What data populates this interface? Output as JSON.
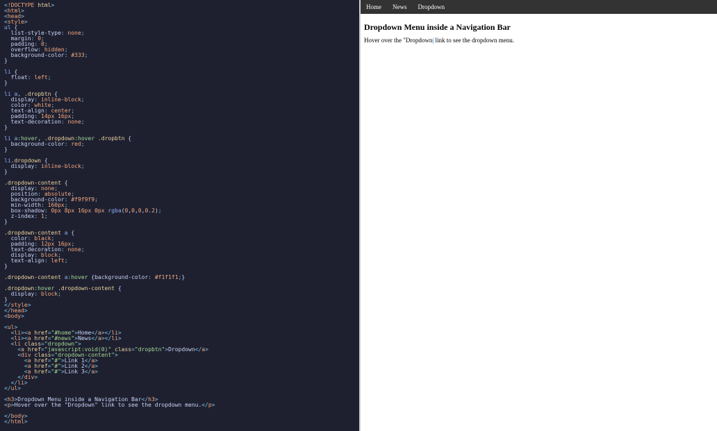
{
  "code": {
    "lines": [
      {
        "t": "tag",
        "text": "<!DOCTYPE html>"
      },
      {
        "t": "tag",
        "text": "<html>"
      },
      {
        "t": "tag",
        "text": "<head>"
      },
      {
        "t": "tag",
        "text": "<style>"
      },
      {
        "t": "sel",
        "text": "ul {"
      },
      {
        "t": "prop",
        "text": "  list-style-type: none;"
      },
      {
        "t": "prop",
        "text": "  margin: 0;"
      },
      {
        "t": "prop",
        "text": "  padding: 0;"
      },
      {
        "t": "prop",
        "text": "  overflow: hidden;"
      },
      {
        "t": "prop",
        "text": "  background-color: #333;"
      },
      {
        "t": "brace",
        "text": "}"
      },
      {
        "t": "blank",
        "text": ""
      },
      {
        "t": "sel",
        "text": "li {"
      },
      {
        "t": "prop",
        "text": "  float: left;"
      },
      {
        "t": "brace",
        "text": "}"
      },
      {
        "t": "blank",
        "text": ""
      },
      {
        "t": "sel",
        "text": "li a, .dropbtn {"
      },
      {
        "t": "prop",
        "text": "  display: inline-block;"
      },
      {
        "t": "prop",
        "text": "  color: white;"
      },
      {
        "t": "prop",
        "text": "  text-align: center;"
      },
      {
        "t": "prop",
        "text": "  padding: 14px 16px;"
      },
      {
        "t": "prop",
        "text": "  text-decoration: none;"
      },
      {
        "t": "brace",
        "text": "}"
      },
      {
        "t": "blank",
        "text": ""
      },
      {
        "t": "sel",
        "text": "li a:hover, .dropdown:hover .dropbtn {"
      },
      {
        "t": "prop",
        "text": "  background-color: red;"
      },
      {
        "t": "brace",
        "text": "}"
      },
      {
        "t": "blank",
        "text": ""
      },
      {
        "t": "sel",
        "text": "li.dropdown {"
      },
      {
        "t": "prop",
        "text": "  display: inline-block;"
      },
      {
        "t": "brace",
        "text": "}"
      },
      {
        "t": "blank",
        "text": ""
      },
      {
        "t": "sel",
        "text": ".dropdown-content {"
      },
      {
        "t": "prop",
        "text": "  display: none;"
      },
      {
        "t": "prop",
        "text": "  position: absolute;"
      },
      {
        "t": "prop",
        "text": "  background-color: #f9f9f9;"
      },
      {
        "t": "prop",
        "text": "  min-width: 160px;"
      },
      {
        "t": "prop",
        "text": "  box-shadow: 0px 8px 16px 0px rgba(0,0,0,0.2);"
      },
      {
        "t": "prop",
        "text": "  z-index: 1;"
      },
      {
        "t": "brace",
        "text": "}"
      },
      {
        "t": "blank",
        "text": ""
      },
      {
        "t": "sel",
        "text": ".dropdown-content a {"
      },
      {
        "t": "prop",
        "text": "  color: black;"
      },
      {
        "t": "prop",
        "text": "  padding: 12px 16px;"
      },
      {
        "t": "prop",
        "text": "  text-decoration: none;"
      },
      {
        "t": "prop",
        "text": "  display: block;"
      },
      {
        "t": "prop",
        "text": "  text-align: left;"
      },
      {
        "t": "brace",
        "text": "}"
      },
      {
        "t": "blank",
        "text": ""
      },
      {
        "t": "sel",
        "text": ".dropdown-content a:hover {background-color: #f1f1f1;}"
      },
      {
        "t": "blank",
        "text": ""
      },
      {
        "t": "sel",
        "text": ".dropdown:hover .dropdown-content {"
      },
      {
        "t": "prop",
        "text": "  display: block;"
      },
      {
        "t": "brace",
        "text": "}"
      },
      {
        "t": "tag",
        "text": "</style>"
      },
      {
        "t": "tag",
        "text": "</head>"
      },
      {
        "t": "tag",
        "text": "<body>"
      },
      {
        "t": "blank",
        "text": ""
      },
      {
        "t": "tag",
        "text": "<ul>"
      },
      {
        "t": "html",
        "text": "  <li><a href=\"#home\">Home</a></li>"
      },
      {
        "t": "html",
        "text": "  <li><a href=\"#news\">News</a></li>"
      },
      {
        "t": "html",
        "text": "  <li class=\"dropdown\">"
      },
      {
        "t": "html",
        "text": "    <a href=\"javascript:void(0)\" class=\"dropbtn\">Dropdown</a>"
      },
      {
        "t": "html",
        "text": "    <div class=\"dropdown-content\">"
      },
      {
        "t": "html",
        "text": "      <a href=\"#\">Link 1</a>"
      },
      {
        "t": "html",
        "text": "      <a href=\"#\">Link 2</a>"
      },
      {
        "t": "html",
        "text": "      <a href=\"#\">Link 3</a>"
      },
      {
        "t": "html",
        "text": "    </div>"
      },
      {
        "t": "html",
        "text": "  </li>"
      },
      {
        "t": "tag",
        "text": "</ul>"
      },
      {
        "t": "blank",
        "text": ""
      },
      {
        "t": "html",
        "text": "<h3>Dropdown Menu inside a Navigation Bar</h3>"
      },
      {
        "t": "html",
        "text": "<p>Hover over the \"Dropdown\" link to see the dropdown menu.</p>"
      },
      {
        "t": "blank",
        "text": ""
      },
      {
        "t": "tag",
        "text": "</body>"
      },
      {
        "t": "tag",
        "text": "</html>"
      }
    ]
  },
  "preview": {
    "nav": {
      "home": "Home",
      "news": "News",
      "dropdown": "Dropdown"
    },
    "heading": "Dropdown Menu inside a Navigation Bar",
    "paragraph_pre": "Hover over the \"Dropdown",
    "paragraph_cursor": "|",
    "paragraph_post": " link to see the dropdown menu."
  }
}
